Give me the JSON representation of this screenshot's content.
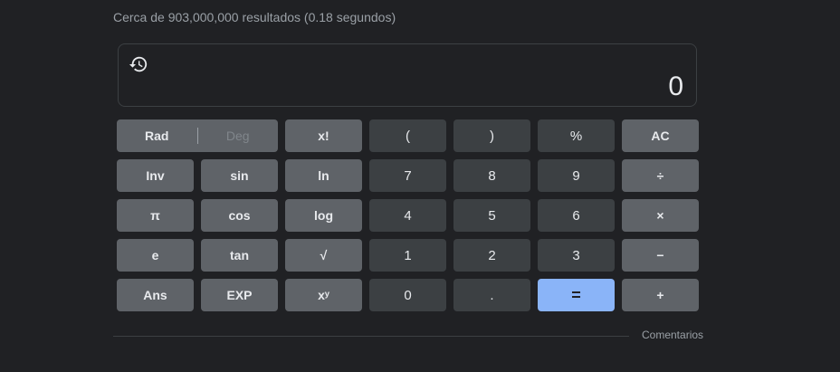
{
  "results": {
    "stats": "Cerca de 903,000,000 resultados (0.18 segundos)"
  },
  "display": {
    "history_icon": "history-icon",
    "value": "0"
  },
  "keys": {
    "rad": "Rad",
    "deg": "Deg",
    "factorial": "x!",
    "open_paren": "(",
    "close_paren": ")",
    "percent": "%",
    "clear": "AC",
    "inv": "Inv",
    "sin": "sin",
    "ln": "ln",
    "seven": "7",
    "eight": "8",
    "nine": "9",
    "divide": "÷",
    "pi": "π",
    "cos": "cos",
    "log": "log",
    "four": "4",
    "five": "5",
    "six": "6",
    "multiply": "×",
    "e": "e",
    "tan": "tan",
    "sqrt": "√",
    "one": "1",
    "two": "2",
    "three": "3",
    "minus": "−",
    "ans": "Ans",
    "exp": "EXP",
    "power": "xʸ",
    "zero": "0",
    "dot": ".",
    "equals": "=",
    "plus": "+"
  },
  "footer": {
    "feedback": "Comentarios"
  },
  "colors": {
    "background": "#202124",
    "function_key": "#5f6368",
    "number_key": "#3c4043",
    "equals_key": "#8ab4f8",
    "text": "#e8eaed"
  }
}
